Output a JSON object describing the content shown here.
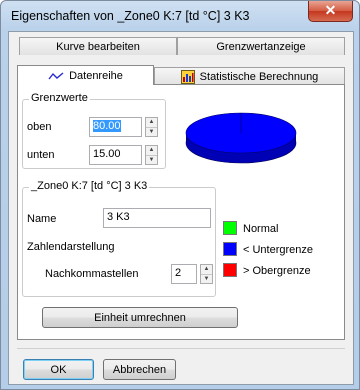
{
  "window": {
    "title": "Eigenschaften von _Zone0 K:7 [td °C] 3 K3",
    "close_glyph": "✕"
  },
  "tabs": {
    "row1": [
      "Kurve bearbeiten",
      "Grenzwertanzeige"
    ],
    "row2": [
      {
        "label": "Datenreihe",
        "icon": "series-line-icon",
        "active": true
      },
      {
        "label": "Statistische Berechnung",
        "icon": "statistics-icon",
        "active": false
      }
    ]
  },
  "grenzwerte": {
    "group_label": "Grenzwerte",
    "oben_label": "oben",
    "oben_value": "80.00",
    "unten_label": "unten",
    "unten_value": "15.00"
  },
  "series": {
    "group_label": "_Zone0 K:7 [td °C] 3 K3",
    "name_label": "Name",
    "name_value": "3 K3",
    "zahlen_label": "Zahlendarstellung",
    "nachkomma_label": "Nachkommastellen",
    "nachkomma_value": "2"
  },
  "pie": {
    "type": "pie",
    "slices": [
      {
        "label": "< Untergrenze",
        "color": "#0000ff",
        "fraction": 1.0
      }
    ]
  },
  "legend": [
    {
      "label": "Normal",
      "color": "#00ff00"
    },
    {
      "label": "< Untergrenze",
      "color": "#0000ff"
    },
    {
      "label": "> Obergrenze",
      "color": "#ff0000"
    }
  ],
  "buttons": {
    "convert": "Einheit umrechnen",
    "ok": "OK",
    "cancel": "Abbrechen"
  }
}
